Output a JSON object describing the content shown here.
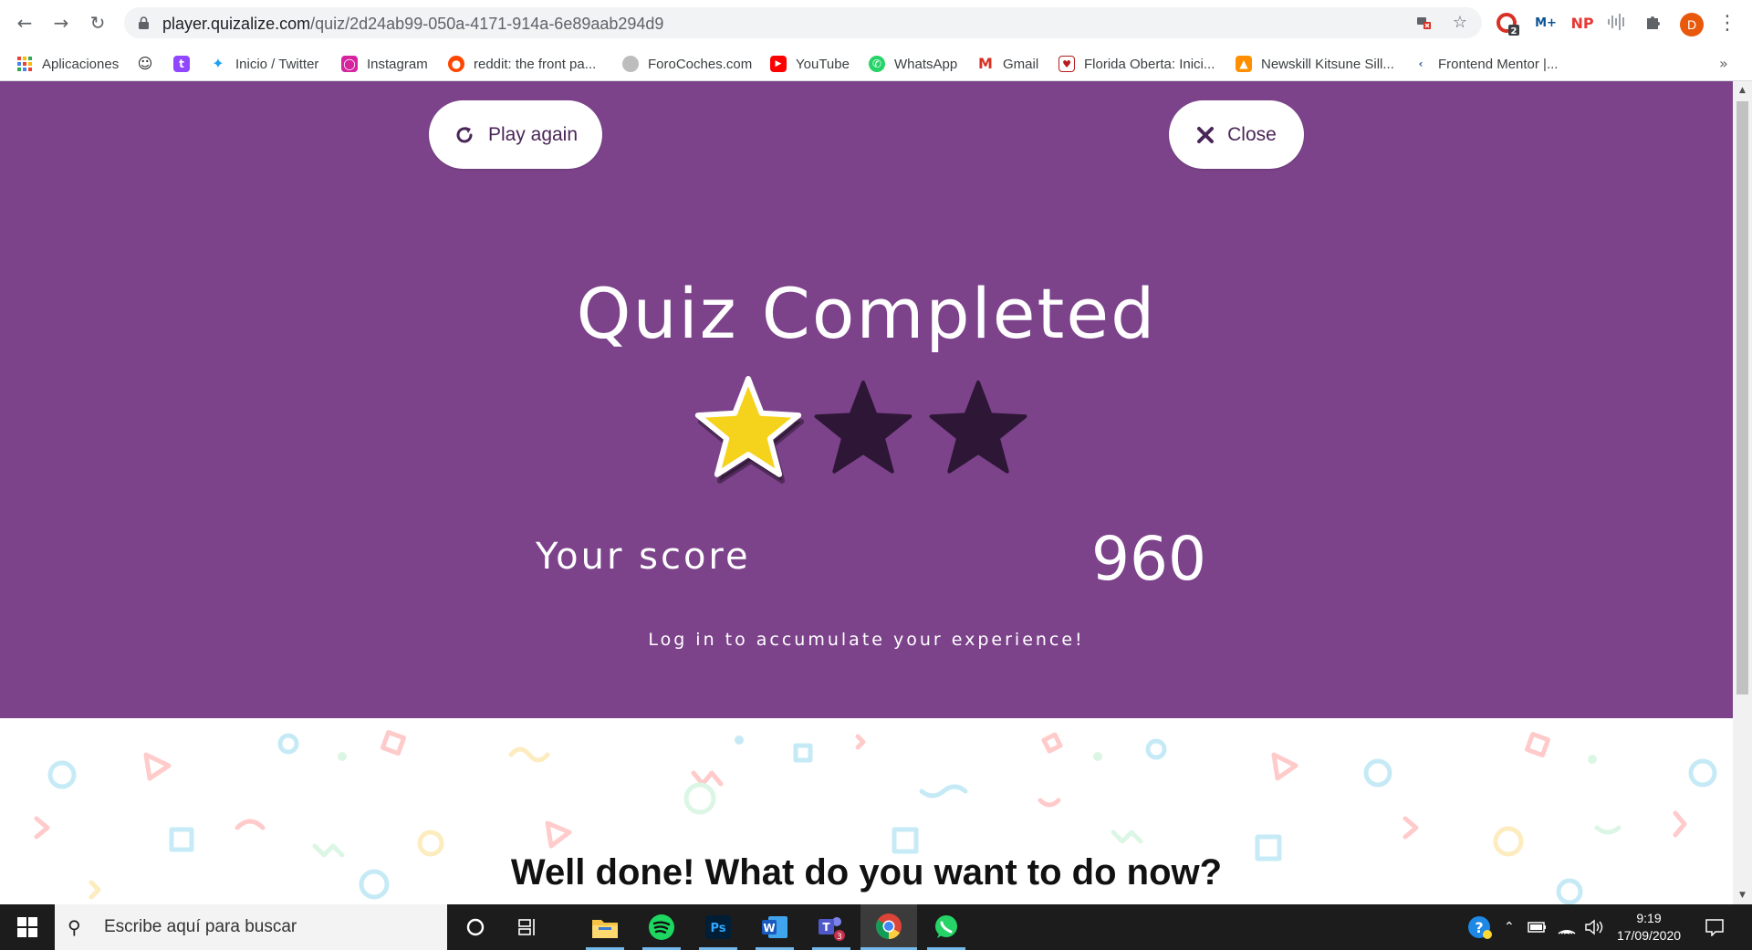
{
  "browser": {
    "url_host": "player.quizalize.com",
    "url_path": "/quiz/2d24ab99-050a-4171-914a-6e89aab294d9",
    "profile_initial": "D",
    "extensions": [
      "C",
      "M+",
      "NP"
    ],
    "extension_badge": "2",
    "bookmarks": [
      {
        "label": "Aplicaciones",
        "icon": "apps-grid-icon",
        "color": "#ea4335"
      },
      {
        "label": "",
        "icon": "smile-icon",
        "color": "#202124"
      },
      {
        "label": "",
        "icon": "twitch-icon",
        "color": "#9146ff"
      },
      {
        "label": "Inicio / Twitter",
        "icon": "twitter-icon",
        "color": "#1da1f2"
      },
      {
        "label": "Instagram",
        "icon": "instagram-icon",
        "color": "#d6249f"
      },
      {
        "label": "reddit: the front pa...",
        "icon": "reddit-icon",
        "color": "#ff4500"
      },
      {
        "label": "ForoCoches.com",
        "icon": "forocoches-icon",
        "color": "#9e9e9e"
      },
      {
        "label": "YouTube",
        "icon": "youtube-icon",
        "color": "#ff0000"
      },
      {
        "label": "WhatsApp",
        "icon": "whatsapp-icon",
        "color": "#25d366"
      },
      {
        "label": "Gmail",
        "icon": "gmail-icon",
        "color": "#d93025"
      },
      {
        "label": "Florida Oberta: Inici...",
        "icon": "florida-icon",
        "color": "#b71c1c"
      },
      {
        "label": "Newskill Kitsune Sill...",
        "icon": "newskill-icon",
        "color": "#ff8f00"
      },
      {
        "label": "Frontend Mentor |...",
        "icon": "frontend-mentor-icon",
        "color": "#3e54a3"
      }
    ]
  },
  "page": {
    "play_again_label": "Play again",
    "close_label": "Close",
    "title": "Quiz Completed",
    "stars_earned": 1,
    "stars_total": 3,
    "score_label": "Your score",
    "score_value": "960",
    "login_hint": "Log in to accumulate your experience!",
    "prompt": "Well done! What do you want to do now?",
    "colors": {
      "hero_bg": "#7c438b",
      "star_filled": "#f5d21c",
      "star_empty": "#2e1636"
    }
  },
  "taskbar": {
    "search_placeholder": "Escribe aquí para buscar",
    "apps": [
      "task-view",
      "file-explorer",
      "spotify",
      "photoshop",
      "word",
      "teams",
      "chrome",
      "whatsapp"
    ],
    "teams_badge": "3",
    "time": "9:19",
    "date": "17/09/2020"
  }
}
